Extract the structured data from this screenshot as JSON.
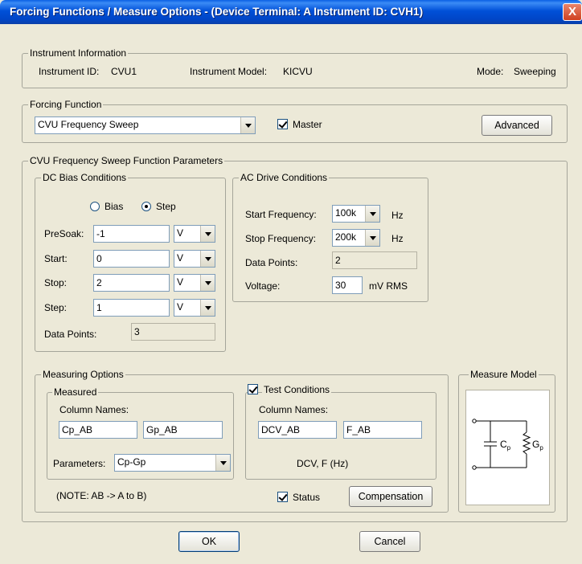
{
  "window": {
    "title": "Forcing Functions / Measure Options - (Device Terminal: A  Instrument ID: CVH1)",
    "close": "X"
  },
  "instrument_info": {
    "legend": "Instrument Information",
    "id_label": "Instrument ID:",
    "id_value": "CVU1",
    "model_label": "Instrument Model:",
    "model_value": "KICVU",
    "mode_label": "Mode:",
    "mode_value": "Sweeping"
  },
  "forcing_function": {
    "legend": "Forcing Function",
    "selected": "CVU Frequency Sweep",
    "master_label": "Master",
    "master_checked": true,
    "advanced_label": "Advanced"
  },
  "sweep_params": {
    "legend": "CVU Frequency Sweep Function Parameters",
    "dc_bias": {
      "legend": "DC Bias Conditions",
      "bias_label": "Bias",
      "step_label": "Step",
      "selected_mode": "Step",
      "presoak_label": "PreSoak:",
      "presoak_value": "-1",
      "presoak_unit": "V",
      "start_label": "Start:",
      "start_value": "0",
      "start_unit": "V",
      "stop_label": "Stop:",
      "stop_value": "2",
      "stop_unit": "V",
      "step_label_row": "Step:",
      "step_value": "1",
      "step_unit": "V",
      "datapoints_label": "Data Points:",
      "datapoints_value": "3"
    },
    "ac_drive": {
      "legend": "AC Drive Conditions",
      "start_freq_label": "Start Frequency:",
      "start_freq_value": "100k",
      "start_freq_unit": "Hz",
      "stop_freq_label": "Stop Frequency:",
      "stop_freq_value": "200k",
      "stop_freq_unit": "Hz",
      "datapoints_label": "Data Points:",
      "datapoints_value": "2",
      "voltage_label": "Voltage:",
      "voltage_value": "30",
      "voltage_unit": "mV RMS"
    }
  },
  "measuring": {
    "legend": "Measuring Options",
    "measured": {
      "legend": "Measured",
      "colnames_label": "Column Names:",
      "col1": "Cp_AB",
      "col2": "Gp_AB",
      "params_label": "Parameters:",
      "params_value": "Cp-Gp"
    },
    "test_conditions": {
      "label": "Test Conditions",
      "checked": true,
      "colnames_label": "Column Names:",
      "col1": "DCV_AB",
      "col2": "F_AB",
      "desc": "DCV, F (Hz)"
    },
    "note": "(NOTE: AB -> A to B)",
    "status_label": "Status",
    "status_checked": true,
    "compensation_label": "Compensation"
  },
  "measure_model": {
    "legend": "Measure Model",
    "cap_label": "C",
    "cap_sub": "p",
    "cond_label": "G",
    "cond_sub": "p"
  },
  "footer": {
    "ok_label": "OK",
    "cancel_label": "Cancel"
  }
}
